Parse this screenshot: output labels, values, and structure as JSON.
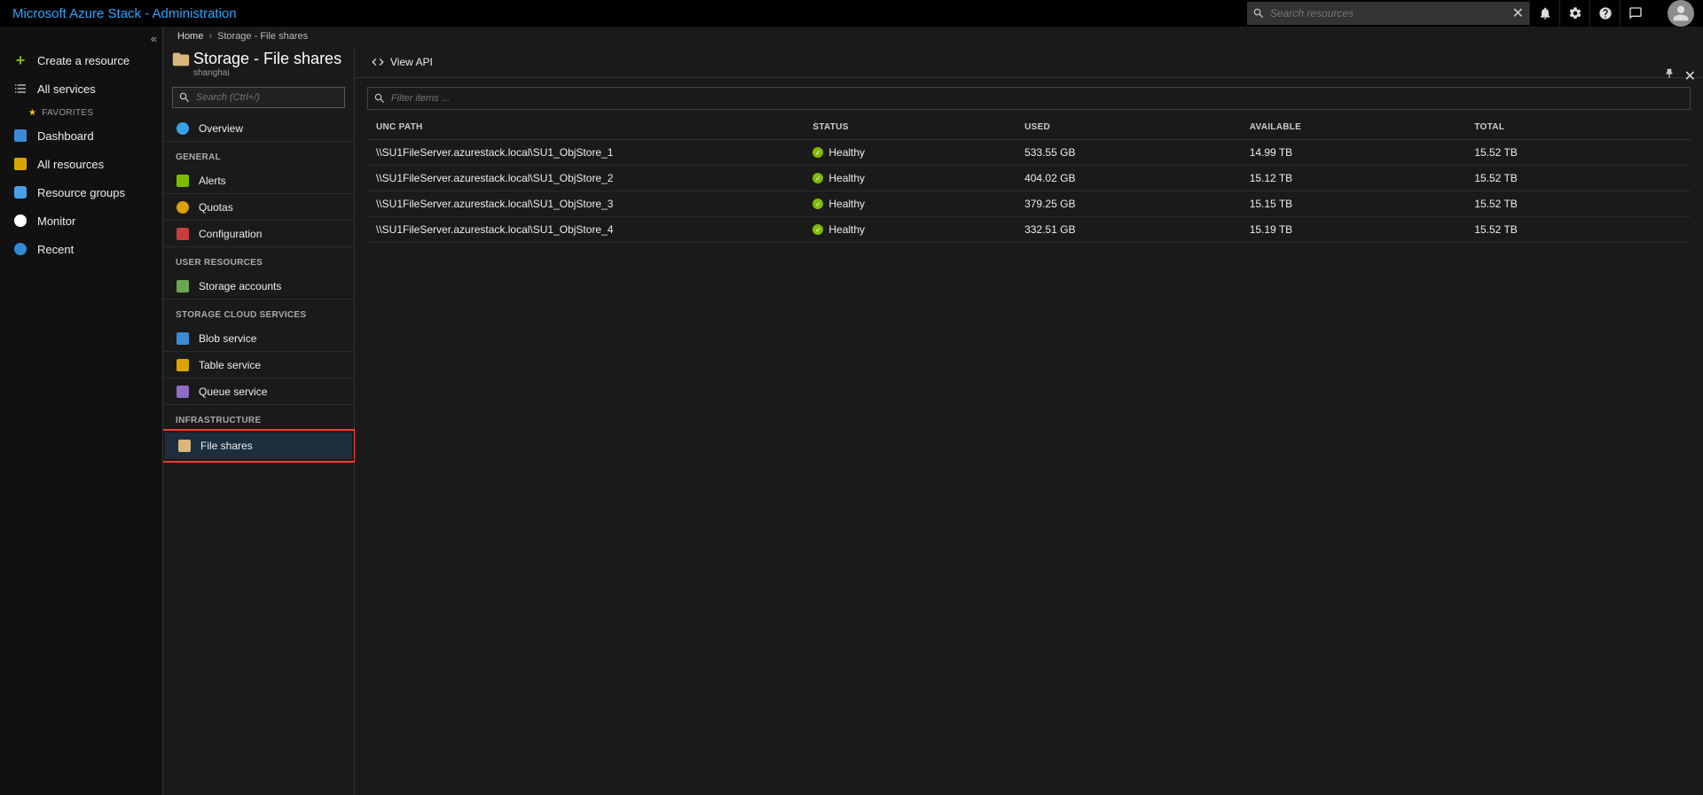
{
  "topbar": {
    "title": "Microsoft Azure Stack  - Administration",
    "search_placeholder": "Search resources"
  },
  "leftnav": {
    "create": "Create a resource",
    "allservices": "All services",
    "favorites_label": "FAVORITES",
    "items": [
      "Dashboard",
      "All resources",
      "Resource groups",
      "Monitor",
      "Recent"
    ]
  },
  "breadcrumbs": {
    "home": "Home",
    "current": "Storage - File shares"
  },
  "blade": {
    "title": "Storage - File shares",
    "subtitle": "shanghai",
    "search_placeholder": "Search (Ctrl+/)",
    "menu": {
      "overview": "Overview",
      "general_label": "GENERAL",
      "general": [
        "Alerts",
        "Quotas",
        "Configuration"
      ],
      "user_label": "USER RESOURCES",
      "user": [
        "Storage accounts"
      ],
      "cloud_label": "STORAGE CLOUD SERVICES",
      "cloud": [
        "Blob service",
        "Table service",
        "Queue service"
      ],
      "infra_label": "INFRASTRUCTURE",
      "infra": [
        "File shares"
      ]
    }
  },
  "commandbar": {
    "view_api": "View API"
  },
  "filter": {
    "placeholder": "Filter items ..."
  },
  "table": {
    "headers": [
      "UNC PATH",
      "STATUS",
      "USED",
      "AVAILABLE",
      "TOTAL"
    ],
    "rows": [
      {
        "unc": "\\\\SU1FileServer.azurestack.local\\SU1_ObjStore_1",
        "status": "Healthy",
        "used": "533.55 GB",
        "available": "14.99 TB",
        "total": "15.52 TB"
      },
      {
        "unc": "\\\\SU1FileServer.azurestack.local\\SU1_ObjStore_2",
        "status": "Healthy",
        "used": "404.02 GB",
        "available": "15.12 TB",
        "total": "15.52 TB"
      },
      {
        "unc": "\\\\SU1FileServer.azurestack.local\\SU1_ObjStore_3",
        "status": "Healthy",
        "used": "379.25 GB",
        "available": "15.15 TB",
        "total": "15.52 TB"
      },
      {
        "unc": "\\\\SU1FileServer.azurestack.local\\SU1_ObjStore_4",
        "status": "Healthy",
        "used": "332.51 GB",
        "available": "15.19 TB",
        "total": "15.52 TB"
      }
    ]
  }
}
